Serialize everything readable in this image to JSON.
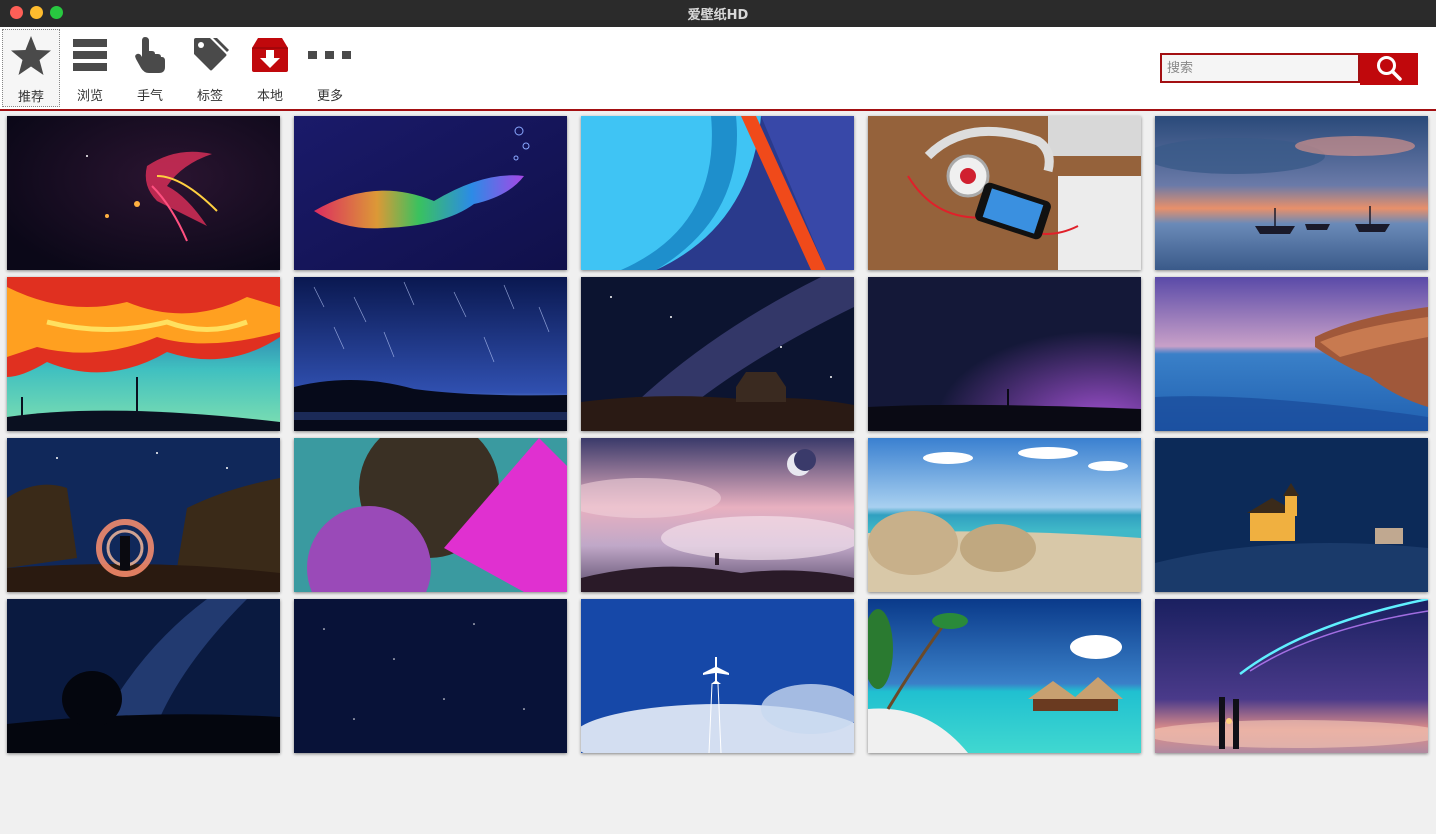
{
  "window": {
    "title": "爱壁纸HD"
  },
  "toolbar": {
    "items": [
      {
        "label": "推荐",
        "icon": "star-icon"
      },
      {
        "label": "浏览",
        "icon": "list-icon"
      },
      {
        "label": "手气",
        "icon": "hand-pointer-icon"
      },
      {
        "label": "标签",
        "icon": "tags-icon"
      },
      {
        "label": "本地",
        "icon": "local-download-icon"
      },
      {
        "label": "更多",
        "icon": "more-dots-icon"
      }
    ],
    "active_index": 0
  },
  "search": {
    "placeholder": "搜索",
    "value": "",
    "button_icon": "search-icon"
  },
  "colors": {
    "accent": "#c0080c",
    "border_accent": "#a30f12",
    "titlebar": "#2b2b2b"
  },
  "wallpapers": [
    {
      "name": "neon-phoenix-wallpaper"
    },
    {
      "name": "rainbow-fish-wallpaper"
    },
    {
      "name": "material-design-wallpaper"
    },
    {
      "name": "headphones-phone-wallpaper"
    },
    {
      "name": "sunset-boats-wallpaper"
    },
    {
      "name": "fiery-clouds-wallpaper"
    },
    {
      "name": "star-trails-lake-wallpaper"
    },
    {
      "name": "milky-way-church-wallpaper"
    },
    {
      "name": "night-sky-purple-wallpaper"
    },
    {
      "name": "coastal-cliff-wallpaper"
    },
    {
      "name": "light-painting-wallpaper"
    },
    {
      "name": "geometric-shapes-wallpaper"
    },
    {
      "name": "moon-clouds-wallpaper"
    },
    {
      "name": "beach-rocks-wallpaper"
    },
    {
      "name": "church-night-wallpaper"
    },
    {
      "name": "milky-way-tree-wallpaper"
    },
    {
      "name": "dark-starfield-wallpaper"
    },
    {
      "name": "airplane-sky-wallpaper"
    },
    {
      "name": "tropical-beach-wallpaper"
    },
    {
      "name": "comet-couple-wallpaper"
    }
  ]
}
